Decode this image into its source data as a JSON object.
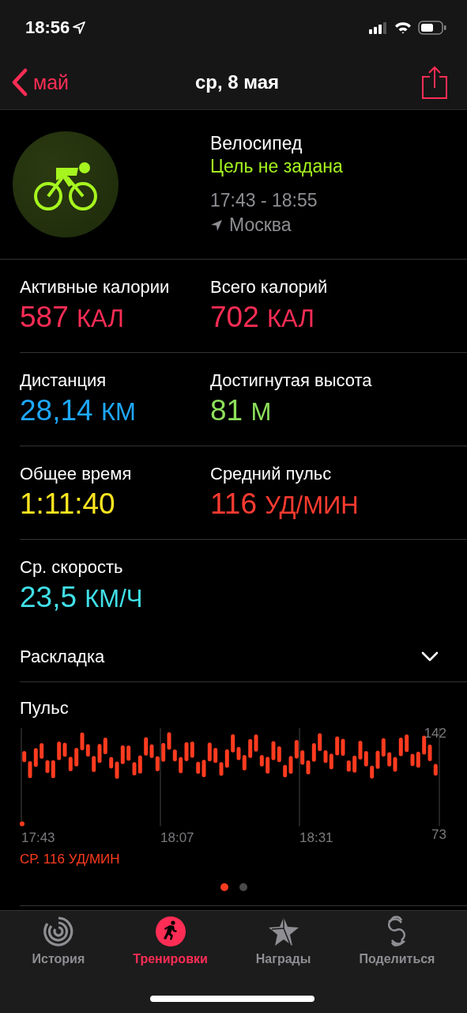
{
  "status_bar": {
    "time": "18:56"
  },
  "nav": {
    "back": "май",
    "title": "ср, 8 мая"
  },
  "workout": {
    "name": "Велосипед",
    "goal": "Цель не задана",
    "time_range": "17:43 - 18:55",
    "location": "Москва"
  },
  "stats": [
    {
      "label": "Активные калории",
      "value": "587",
      "unit": "КАЛ",
      "color": "#ff2d55"
    },
    {
      "label": "Всего калорий",
      "value": "702",
      "unit": "КАЛ",
      "color": "#ff2d55"
    },
    {
      "label": "Дистанция",
      "value": "28,14",
      "unit": "КМ",
      "color": "#1ea8ff"
    },
    {
      "label": "Достигнутая высота",
      "value": "81",
      "unit": "М",
      "color": "#8ee05a"
    },
    {
      "label": "Общее время",
      "value": "1:11:40",
      "color": "#ffe620"
    },
    {
      "label": "Средний пульс",
      "value": "116",
      "unit": "УД/МИН",
      "color": "#ff3b30"
    },
    {
      "label": "Ср. скорость",
      "value": "23,5",
      "unit": "КМ/Ч",
      "color": "#40e0e8"
    }
  ],
  "splits": {
    "label": "Раскладка",
    "expanded": false
  },
  "heart_rate": {
    "title": "Пульс",
    "average": "СР. 116 УД/МИН",
    "y_labels": [
      "142",
      "73"
    ],
    "x_labels": [
      "17:43",
      "18:07",
      "18:31"
    ],
    "pages": [
      {
        "selected": true
      },
      {
        "selected": false
      }
    ]
  },
  "tab_bar": [
    {
      "label": "История",
      "kind": "rings",
      "selected": false
    },
    {
      "label": "Тренировки",
      "kind": "runner",
      "selected": true
    },
    {
      "label": "Награды",
      "kind": "star",
      "selected": false
    },
    {
      "label": "Поделиться",
      "kind": "share",
      "selected": false
    }
  ]
}
